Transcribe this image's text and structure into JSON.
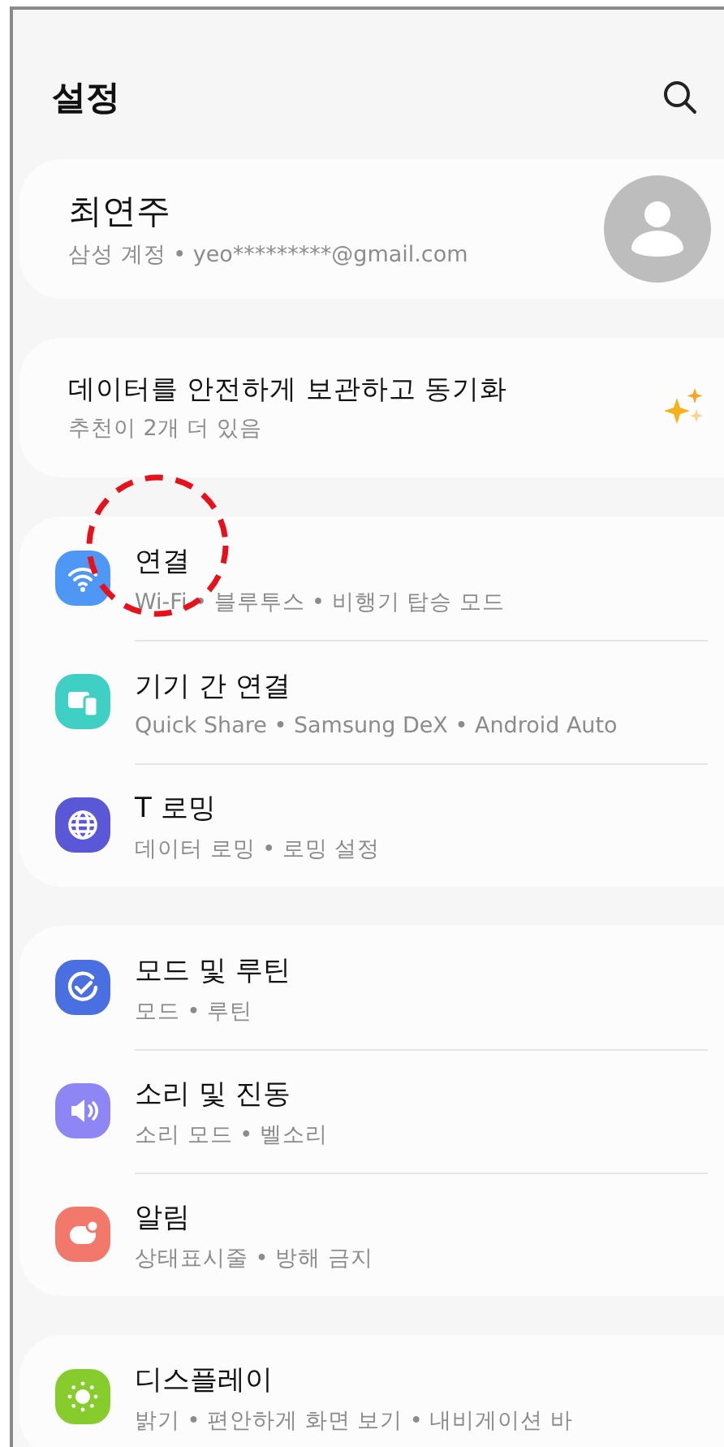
{
  "header": {
    "title": "설정"
  },
  "profile": {
    "name": "최연주",
    "subtitle": "삼성 계정 • yeo*********@gmail.com"
  },
  "suggestion": {
    "title": "데이터를 안전하게 보관하고 동기화",
    "subtitle": "추천이 2개 더 있음"
  },
  "groups": [
    {
      "items": [
        {
          "kind": "wifi",
          "color": "#4f97f5",
          "title": "연결",
          "subtitle": "Wi-Fi • 블루투스 • 비행기 탑승 모드"
        },
        {
          "kind": "devices",
          "color": "#3fcfc4",
          "title": "기기 간 연결",
          "subtitle": "Quick Share • Samsung DeX • Android Auto"
        },
        {
          "kind": "globe",
          "color": "#5b58d8",
          "title": "T 로밍",
          "subtitle": "데이터 로밍 • 로밍 설정"
        }
      ]
    },
    {
      "items": [
        {
          "kind": "routine",
          "color": "#4a6fe0",
          "title": "모드 및 루틴",
          "subtitle": "모드 • 루틴"
        },
        {
          "kind": "sound",
          "color": "#8f86f5",
          "title": "소리 및 진동",
          "subtitle": "소리 모드 • 벨소리"
        },
        {
          "kind": "bell",
          "color": "#f2786b",
          "title": "알림",
          "subtitle": "상태표시줄 • 방해 금지"
        }
      ]
    },
    {
      "items": [
        {
          "kind": "sun",
          "color": "#86cc2c",
          "title": "디스플레이",
          "subtitle": "밝기 • 편안하게 화면 보기 • 내비게이션 바"
        }
      ]
    }
  ]
}
